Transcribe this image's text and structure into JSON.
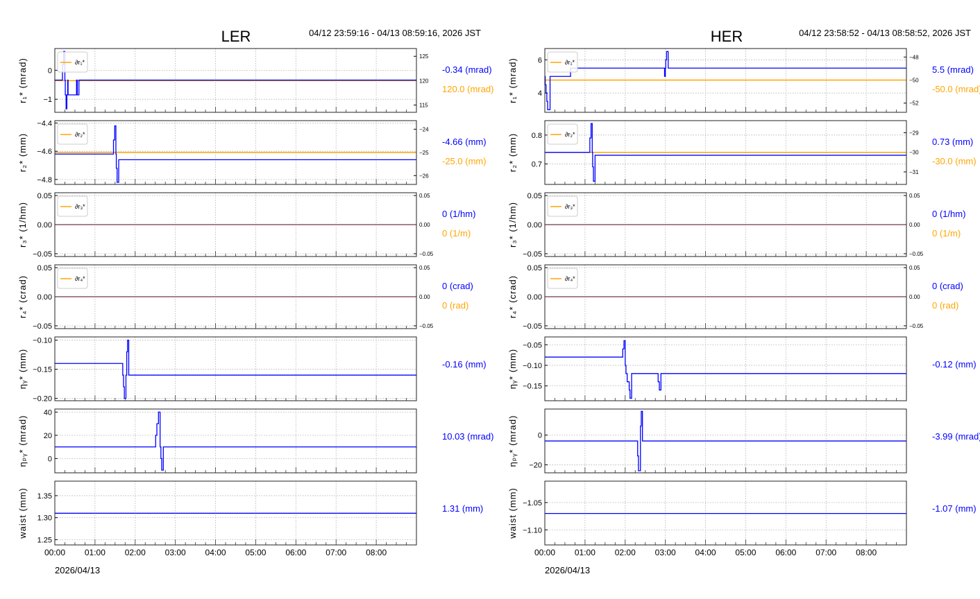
{
  "colors": {
    "blue": "#0000ff",
    "orange": "#ffa500",
    "grid": "#b0b0b0",
    "axis": "#000000"
  },
  "chart_data": [
    {
      "type": "line",
      "title": "LER",
      "time_range": "04/12 23:59:16 - 04/13 08:59:16, 2026 JST",
      "date_label": "2026/04/13",
      "xlim": [
        0,
        9
      ],
      "x_ticks": [
        "00:00",
        "01:00",
        "02:00",
        "03:00",
        "04:00",
        "05:00",
        "06:00",
        "07:00",
        "08:00"
      ],
      "panels": [
        {
          "ylabel": "r₁* (mrad)",
          "ylim": [
            -1.45,
            0.75
          ],
          "yticks": [
            0,
            -1
          ],
          "ytick_labels": [
            "0",
            "−1"
          ],
          "points": [
            [
              0,
              -0.34
            ],
            [
              0.19,
              0.2
            ],
            [
              0.22,
              0.65
            ],
            [
              0.25,
              -0.34
            ],
            [
              0.26,
              -0.85
            ],
            [
              0.28,
              -1.33
            ],
            [
              0.3,
              -0.85
            ],
            [
              0.32,
              -0.34
            ],
            [
              0.33,
              -0.85
            ],
            [
              0.54,
              -0.34
            ],
            [
              0.56,
              -0.85
            ],
            [
              0.6,
              -0.34
            ],
            [
              9,
              -0.34
            ]
          ],
          "right": {
            "ylim": [
              113.5,
              126.6
            ],
            "yticks": [
              125,
              120,
              115
            ],
            "ytick_labels": [
              "125",
              "120",
              "115"
            ],
            "value": 120.0
          },
          "legend": "∂r₁*",
          "current": "-0.34 (mrad)",
          "setpoint": "120.0 (mrad)"
        },
        {
          "ylabel": "r₂* (mm)",
          "ylim": [
            -4.835,
            -4.383
          ],
          "yticks": [
            -4.4,
            -4.6,
            -4.8
          ],
          "ytick_labels": [
            "−4.4",
            "−4.6",
            "−4.8"
          ],
          "points": [
            [
              0,
              -4.62
            ],
            [
              1.46,
              -4.52
            ],
            [
              1.49,
              -4.42
            ],
            [
              1.52,
              -4.62
            ],
            [
              1.53,
              -4.72
            ],
            [
              1.55,
              -4.82
            ],
            [
              1.59,
              -4.66
            ],
            [
              9,
              -4.66
            ]
          ],
          "right": {
            "ylim": [
              -26.38,
              -23.63
            ],
            "yticks": [
              -24,
              -25,
              -26
            ],
            "ytick_labels": [
              "−24",
              "−25",
              "−26"
            ],
            "value": -25.0
          },
          "legend": "∂r₂*",
          "current": "-4.66 (mm)",
          "setpoint": "-25.0 (mm)"
        },
        {
          "ylabel": "r₃* (1/hm)",
          "ylim": [
            -0.0548,
            0.0548
          ],
          "yticks": [
            0.05,
            0,
            -0.05
          ],
          "ytick_labels": [
            "0.05",
            "0.00",
            "−0.05"
          ],
          "points": [
            [
              0,
              0
            ],
            [
              9,
              0
            ]
          ],
          "right": {
            "ylim": [
              -0.0548,
              0.0548
            ],
            "yticks": [
              0.05,
              0,
              -0.05
            ],
            "ytick_labels": [
              "0.05",
              "0.00",
              "−0.05"
            ],
            "value": 0
          },
          "legend": "∂r₃*",
          "current": "0 (1/hm)",
          "setpoint": "0 (1/m)"
        },
        {
          "ylabel": "r₄* (crad)",
          "ylim": [
            -0.0548,
            0.0548
          ],
          "yticks": [
            0.05,
            0,
            -0.05
          ],
          "ytick_labels": [
            "0.05",
            "0.00",
            "−0.05"
          ],
          "points": [
            [
              0,
              0
            ],
            [
              9,
              0
            ]
          ],
          "right": {
            "ylim": [
              -0.0548,
              0.0548
            ],
            "yticks": [
              0.05,
              0,
              -0.05
            ],
            "ytick_labels": [
              "0.05",
              "0.00",
              "−0.05"
            ],
            "value": 0
          },
          "legend": "∂r₄*",
          "current": "0 (crad)",
          "setpoint": "0 (rad)"
        },
        {
          "ylabel": "ηᵧ* (mm)",
          "ylim": [
            -0.204,
            -0.0944
          ],
          "yticks": [
            -0.1,
            -0.15,
            -0.2
          ],
          "ytick_labels": [
            "−0.10",
            "−0.15",
            "−0.20"
          ],
          "points": [
            [
              0,
              -0.14
            ],
            [
              1.69,
              -0.16
            ],
            [
              1.71,
              -0.18
            ],
            [
              1.73,
              -0.2
            ],
            [
              1.77,
              -0.16
            ],
            [
              1.79,
              -0.12
            ],
            [
              1.81,
              -0.1
            ],
            [
              1.84,
              -0.16
            ],
            [
              9,
              -0.16
            ]
          ],
          "current": "-0.16 (mm)"
        },
        {
          "ylabel": "ηₚᵧ* (mrad)",
          "ylim": [
            -12.3,
            42.6
          ],
          "yticks": [
            40,
            20,
            0
          ],
          "ytick_labels": [
            "40",
            "20",
            "0"
          ],
          "points": [
            [
              0,
              10
            ],
            [
              2.51,
              20
            ],
            [
              2.54,
              30
            ],
            [
              2.58,
              40
            ],
            [
              2.62,
              10
            ],
            [
              2.64,
              0
            ],
            [
              2.66,
              -10
            ],
            [
              2.7,
              10
            ],
            [
              9,
              10.03
            ]
          ],
          "current": "10.03 (mrad)"
        },
        {
          "ylabel": "waist (mm)",
          "ylim": [
            1.238,
            1.383
          ],
          "yticks": [
            1.35,
            1.3,
            1.25
          ],
          "ytick_labels": [
            "1.35",
            "1.30",
            "1.25"
          ],
          "points": [
            [
              0,
              1.31
            ],
            [
              9,
              1.31
            ]
          ],
          "current": "1.31 (mm)"
        }
      ]
    },
    {
      "type": "line",
      "title": "HER",
      "time_range": "04/12 23:58:52 - 04/13 08:58:52, 2026 JST",
      "date_label": "2026/04/13",
      "xlim": [
        0,
        9
      ],
      "x_ticks": [
        "00:00",
        "01:00",
        "02:00",
        "03:00",
        "04:00",
        "05:00",
        "06:00",
        "07:00",
        "08:00"
      ],
      "panels": [
        {
          "ylabel": "r₁* (mrad)",
          "ylim": [
            2.84,
            6.68
          ],
          "yticks": [
            6,
            4
          ],
          "ytick_labels": [
            "6",
            "4"
          ],
          "points": [
            [
              0,
              5.0
            ],
            [
              0.01,
              4.5
            ],
            [
              0.03,
              4.0
            ],
            [
              0.05,
              3.5
            ],
            [
              0.07,
              3.0
            ],
            [
              0.13,
              5.0
            ],
            [
              0.64,
              5.5
            ],
            [
              2.98,
              5.0
            ],
            [
              3.0,
              5.5
            ],
            [
              3.01,
              6.0
            ],
            [
              3.03,
              6.5
            ],
            [
              3.07,
              5.5
            ],
            [
              9,
              5.5
            ]
          ],
          "right": {
            "ylim": [
              -52.8,
              -47.26
            ],
            "yticks": [
              -48,
              -50,
              -52
            ],
            "ytick_labels": [
              "−48",
              "−50",
              "−52"
            ],
            "value": -50.0
          },
          "legend": "∂r₁*",
          "current": "5.5 (mrad)",
          "setpoint": "-50.0 (mrad)"
        },
        {
          "ylabel": "r₂* (mm)",
          "ylim": [
            0.629,
            0.85
          ],
          "yticks": [
            0.8,
            0.7
          ],
          "ytick_labels": [
            "0.8",
            "0.7"
          ],
          "points": [
            [
              0,
              0.74
            ],
            [
              1.12,
              0.79
            ],
            [
              1.15,
              0.84
            ],
            [
              1.18,
              0.74
            ],
            [
              1.19,
              0.69
            ],
            [
              1.21,
              0.64
            ],
            [
              1.25,
              0.73
            ],
            [
              9,
              0.73
            ]
          ],
          "right": {
            "ylim": [
              -31.64,
              -28.38
            ],
            "yticks": [
              -29,
              -30,
              -31
            ],
            "ytick_labels": [
              "−29",
              "−30",
              "−31"
            ],
            "value": -30.0
          },
          "legend": "∂r₂*",
          "current": "0.73 (mm)",
          "setpoint": "-30.0 (mm)"
        },
        {
          "ylabel": "r₃* (1/hm)",
          "ylim": [
            -0.0548,
            0.0548
          ],
          "yticks": [
            0.05,
            0,
            -0.05
          ],
          "ytick_labels": [
            "0.05",
            "0.00",
            "−0.05"
          ],
          "points": [
            [
              0,
              0
            ],
            [
              9,
              0
            ]
          ],
          "right": {
            "ylim": [
              -0.0548,
              0.0548
            ],
            "yticks": [
              0.05,
              0,
              -0.05
            ],
            "ytick_labels": [
              "0.05",
              "0.00",
              "−0.05"
            ],
            "value": 0
          },
          "legend": "∂r₃*",
          "current": "0 (1/hm)",
          "setpoint": "0 (1/m)"
        },
        {
          "ylabel": "r₄* (crad)",
          "ylim": [
            -0.0548,
            0.0548
          ],
          "yticks": [
            0.05,
            0,
            -0.05
          ],
          "ytick_labels": [
            "0.05",
            "0.00",
            "−0.05"
          ],
          "points": [
            [
              0,
              0
            ],
            [
              9,
              0
            ]
          ],
          "right": {
            "ylim": [
              -0.0548,
              0.0548
            ],
            "yticks": [
              0.05,
              0,
              -0.05
            ],
            "ytick_labels": [
              "0.05",
              "0.00",
              "−0.05"
            ],
            "value": 0
          },
          "legend": "∂r₄*",
          "current": "0 (crad)",
          "setpoint": "0 (rad)"
        },
        {
          "ylabel": "ηᵧ* (mm)",
          "ylim": [
            -0.186,
            -0.031
          ],
          "yticks": [
            -0.05,
            -0.1,
            -0.15
          ],
          "ytick_labels": [
            "−0.05",
            "−0.10",
            "−0.15"
          ],
          "points": [
            [
              0,
              -0.08
            ],
            [
              1.94,
              -0.06
            ],
            [
              1.97,
              -0.04
            ],
            [
              2.0,
              -0.1
            ],
            [
              2.02,
              -0.12
            ],
            [
              2.05,
              -0.14
            ],
            [
              2.1,
              -0.16
            ],
            [
              2.12,
              -0.18
            ],
            [
              2.16,
              -0.12
            ],
            [
              2.82,
              -0.14
            ],
            [
              2.85,
              -0.16
            ],
            [
              2.89,
              -0.12
            ],
            [
              9,
              -0.12
            ]
          ],
          "current": "-0.12 (mm)"
        },
        {
          "ylabel": "ηₚᵧ* (mrad)",
          "ylim": [
            -25.4,
            17.5
          ],
          "yticks": [
            0,
            -20
          ],
          "ytick_labels": [
            "0",
            "−20"
          ],
          "points": [
            [
              0,
              -3.99
            ],
            [
              2.31,
              -14
            ],
            [
              2.33,
              -24
            ],
            [
              2.38,
              6
            ],
            [
              2.4,
              16
            ],
            [
              2.43,
              -3.99
            ],
            [
              9,
              -3.99
            ]
          ],
          "current": "-3.99 (mrad)"
        },
        {
          "ylabel": "waist (mm)",
          "ylim": [
            -1.1276,
            -1.0108
          ],
          "yticks": [
            -1.05,
            -1.1
          ],
          "ytick_labels": [
            "−1.05",
            "−1.10"
          ],
          "points": [
            [
              0,
              -1.07
            ],
            [
              9,
              -1.07
            ]
          ],
          "current": "-1.07 (mm)"
        }
      ]
    }
  ]
}
